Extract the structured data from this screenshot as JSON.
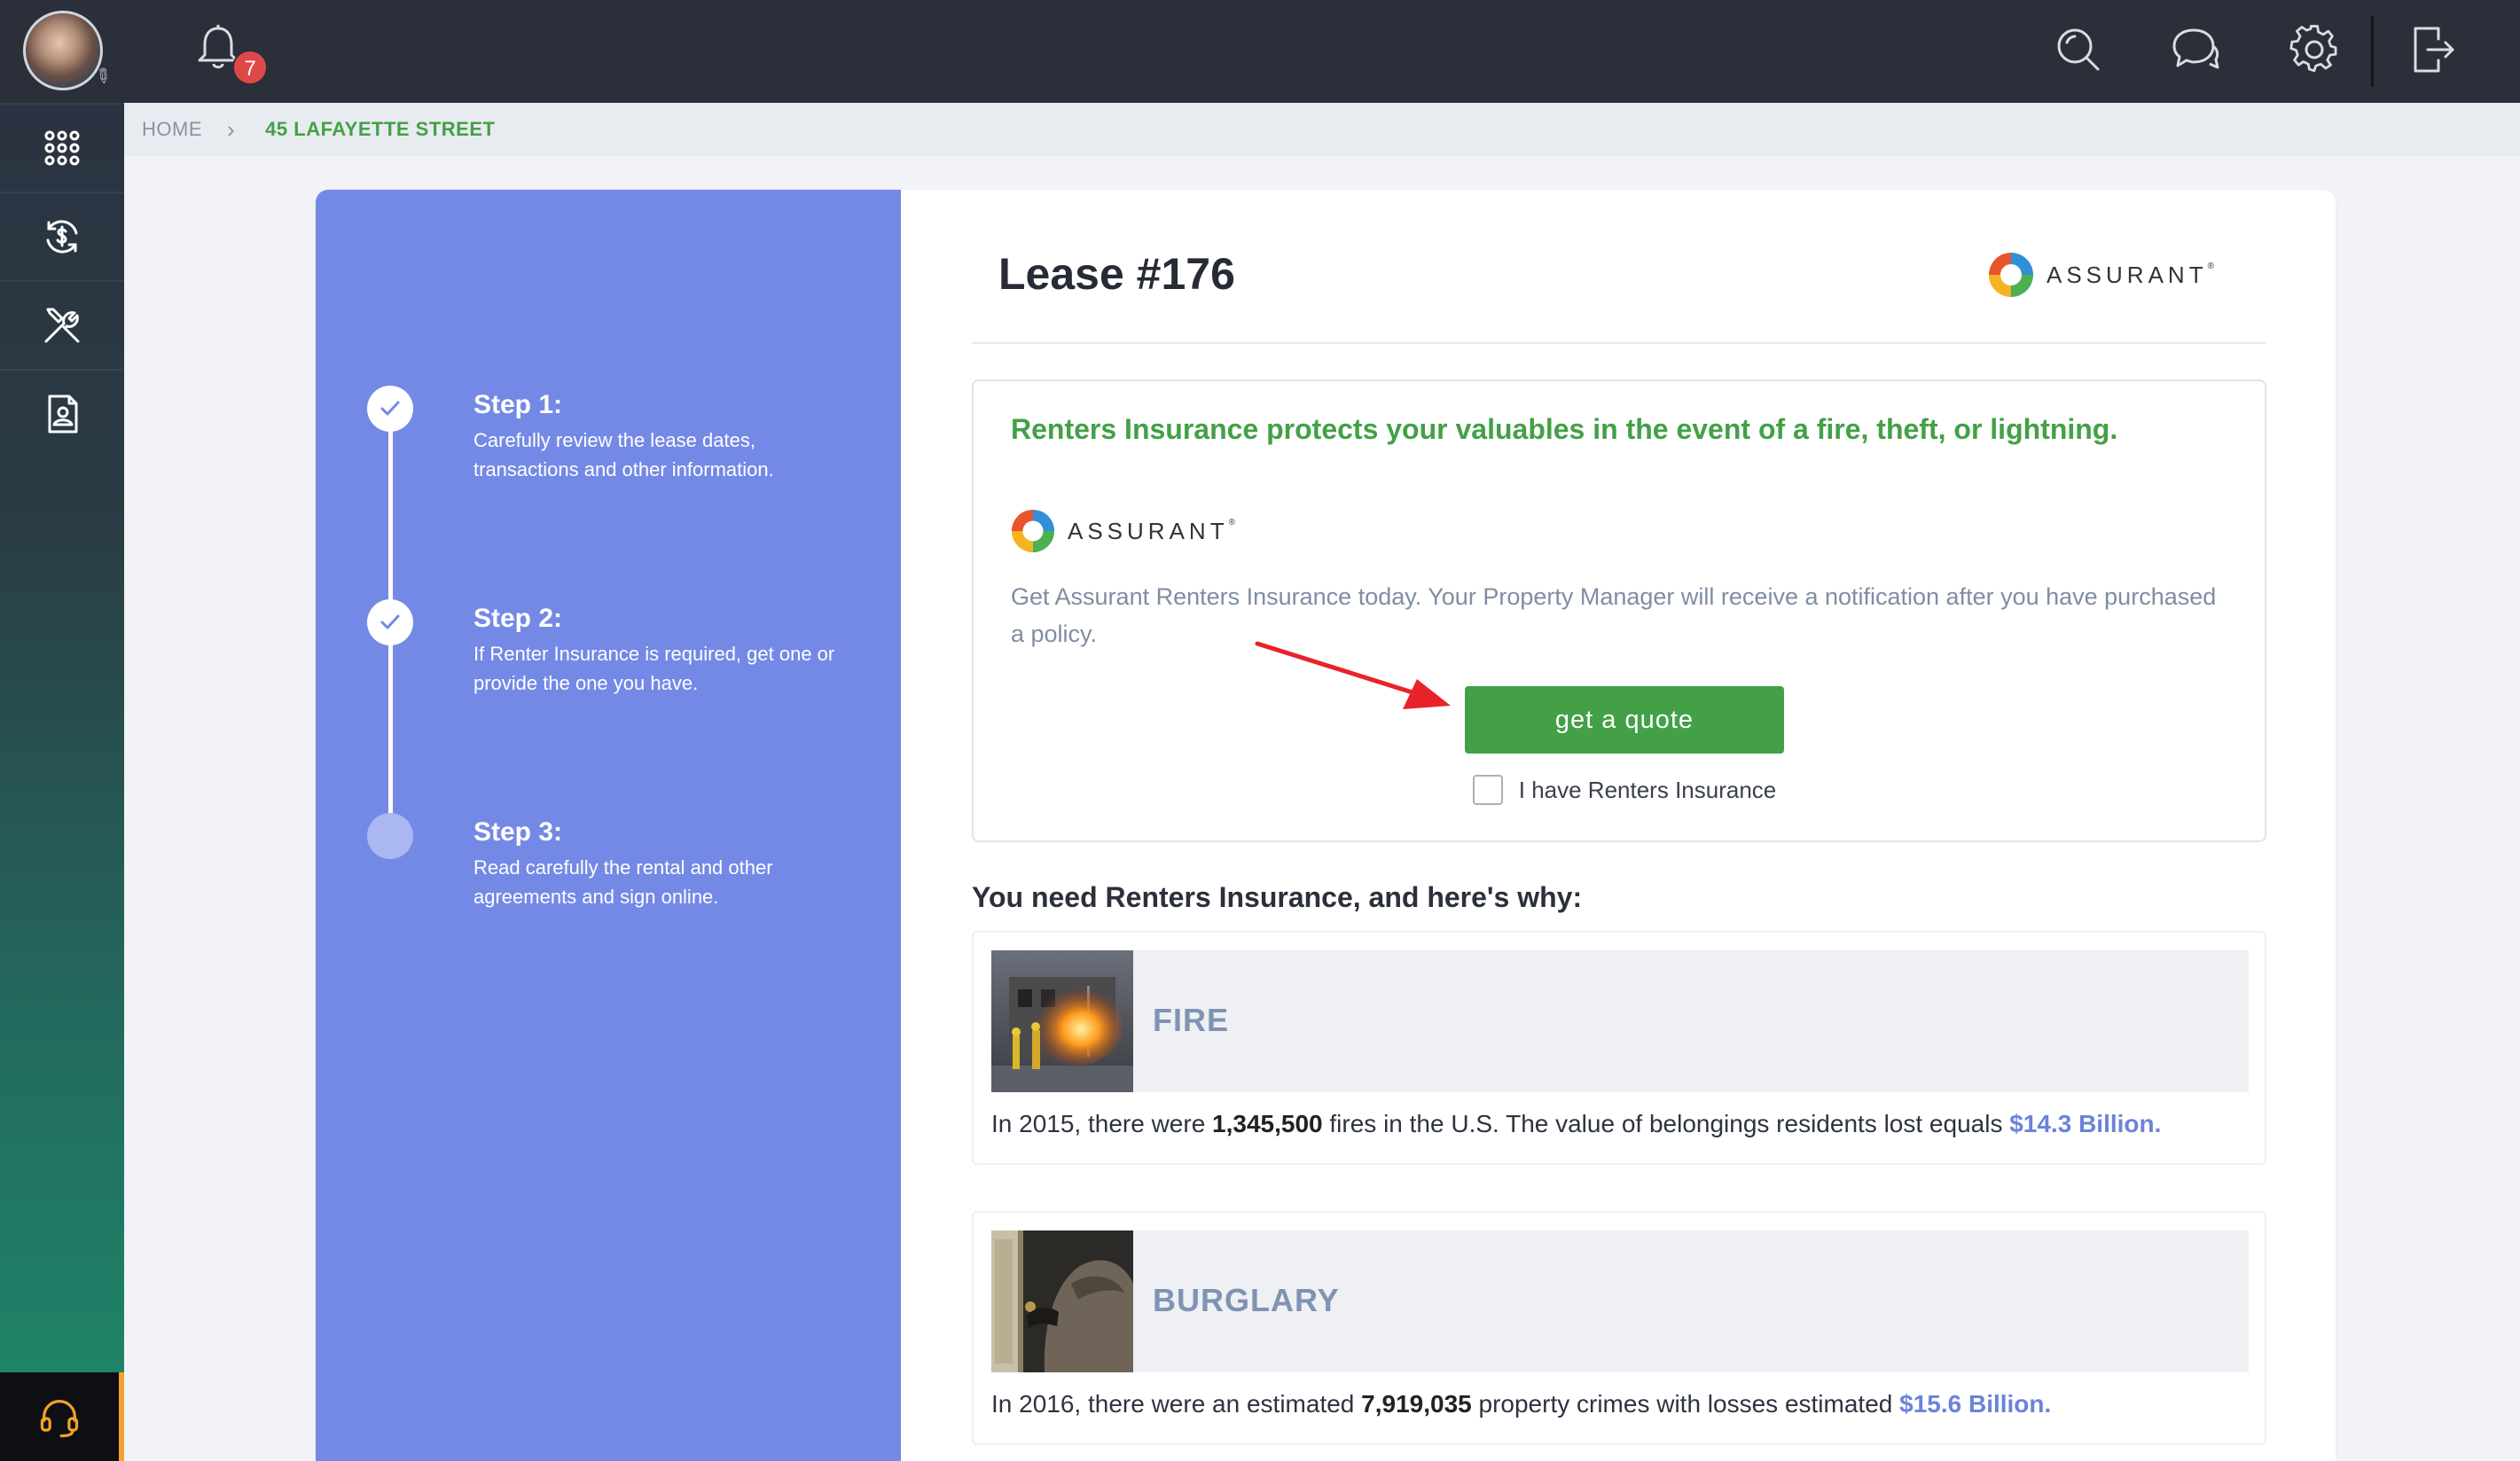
{
  "topbar": {
    "notification_count": "7"
  },
  "breadcrumb": {
    "home": "HOME",
    "separator": "›",
    "current": "45 LAFAYETTE STREET"
  },
  "steps": [
    {
      "title": "Step 1:",
      "desc": "Carefully review the lease dates, transactions and other information.",
      "state": "done"
    },
    {
      "title": "Step 2:",
      "desc": "If Renter Insurance is required, get one or provide the one you have.",
      "state": "done"
    },
    {
      "title": "Step 3:",
      "desc": "Read carefully the rental and other agreements and sign online.",
      "state": "pending"
    }
  ],
  "lease": {
    "title": "Lease #176"
  },
  "brand": {
    "name": "ASSURANT",
    "mark": "®"
  },
  "promo": {
    "headline": "Renters Insurance protects your valuables in the event of a fire, theft, or lightning.",
    "text": "Get Assurant Renters Insurance today. Your Property Manager will receive a notification after you have purchased a policy.",
    "quote_button": "get a quote",
    "have_insurance_label": "I have Renters Insurance"
  },
  "why": {
    "heading": "You need Renters Insurance, and here's why:",
    "items": [
      {
        "title": "FIRE",
        "pre": "In 2015, there were ",
        "bold": "1,345,500",
        "mid": " fires in the U.S. The value of belongings residents lost equals ",
        "amount": "$14.3 Billion."
      },
      {
        "title": "BURGLARY",
        "pre": "In 2016, there were an estimated ",
        "bold": "7,919,035",
        "mid": " property crimes with losses estimated ",
        "amount": "$15.6 Billion."
      }
    ]
  },
  "colors": {
    "steps_panel": "#7489e6",
    "accent_green": "#43a047",
    "badge_red": "#e04848",
    "amount_blue": "#6c83d8",
    "support_accent": "#f2a12c"
  },
  "icons": {
    "sidebar": [
      "apps-grid-icon",
      "dollar-cycle-icon",
      "tools-icon",
      "contact-document-icon"
    ],
    "top": [
      "bell-icon",
      "search-icon",
      "chat-icon",
      "gear-icon",
      "logout-icon"
    ],
    "support": "headset-icon"
  }
}
